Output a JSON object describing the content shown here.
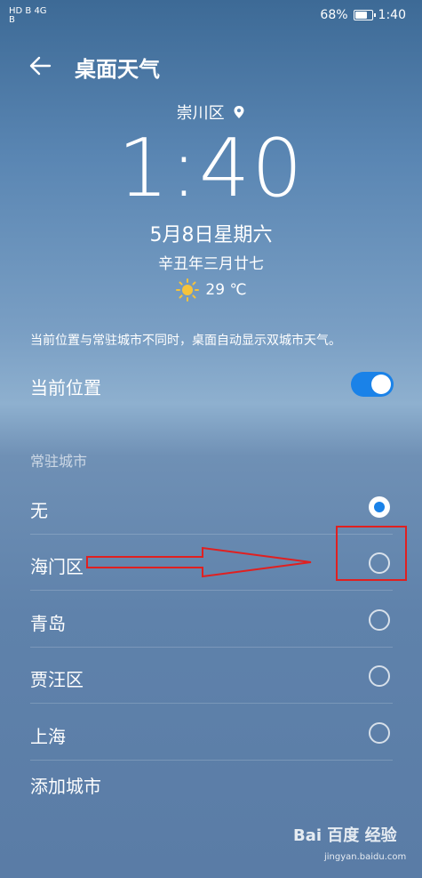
{
  "status_bar": {
    "left_top": "HD B 4G",
    "left_bottom": "B",
    "battery": "68%",
    "time": "1:40"
  },
  "header": {
    "title": "桌面天气"
  },
  "weather": {
    "location": "崇川区",
    "time": "1:40",
    "date": "5月8日星期六",
    "lunar": "辛丑年三月廿七",
    "temperature": "29 ℃"
  },
  "note": "当前位置与常驻城市不同时，桌面自动显示双城市天气。",
  "current_location": {
    "label": "当前位置",
    "enabled": true
  },
  "section_title": "常驻城市",
  "cities": [
    {
      "label": "无",
      "selected": true
    },
    {
      "label": "海门区",
      "selected": false
    },
    {
      "label": "青岛",
      "selected": false
    },
    {
      "label": "贾汪区",
      "selected": false
    },
    {
      "label": "上海",
      "selected": false
    }
  ],
  "add_city": "添加城市",
  "watermark": {
    "brand": "Bai 百度 经验",
    "url": "jingyan.baidu.com"
  },
  "colors": {
    "accent": "#1a82e8",
    "annotation": "#e02020"
  }
}
